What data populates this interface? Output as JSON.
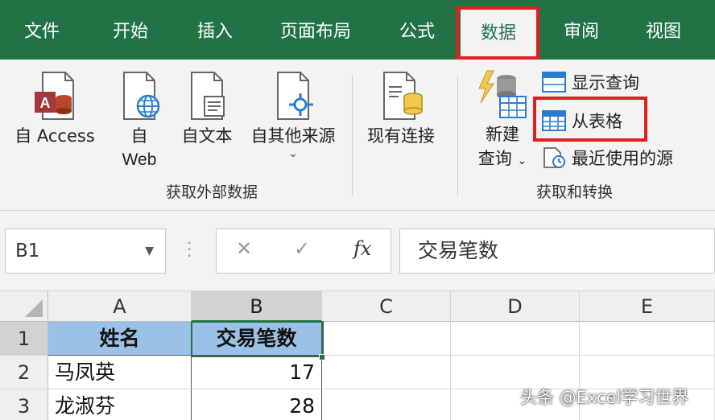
{
  "tabs": [
    {
      "label": "文件"
    },
    {
      "label": "开始"
    },
    {
      "label": "插入"
    },
    {
      "label": "页面布局"
    },
    {
      "label": "公式"
    },
    {
      "label": "数据"
    },
    {
      "label": "审阅"
    },
    {
      "label": "视图"
    }
  ],
  "active_tab": "数据",
  "ribbon": {
    "external_group": {
      "label": "获取外部数据",
      "buttons": [
        {
          "label": "自 Access"
        },
        {
          "label_line1": "自",
          "label_line2": "Web"
        },
        {
          "label": "自文本"
        },
        {
          "label": "自其他来源"
        },
        {
          "label": "现有连接"
        }
      ]
    },
    "transform_group": {
      "label": "获取和转换",
      "new_query": {
        "line1": "新建",
        "line2": "查询"
      },
      "small_buttons": [
        {
          "label": "显示查询"
        },
        {
          "label": "从表格"
        },
        {
          "label": "最近使用的源"
        }
      ]
    }
  },
  "formula_bar": {
    "name_box": "B1",
    "cancel_symbol": "✕",
    "enter_symbol": "✓",
    "fx_symbol": "fx",
    "content": "交易笔数"
  },
  "sheet": {
    "columns": [
      "A",
      "B",
      "C",
      "D",
      "E"
    ],
    "rows": [
      "1",
      "2",
      "3"
    ],
    "cells": {
      "A1": "姓名",
      "B1": "交易笔数",
      "A2": "马凤英",
      "B2": "17",
      "A3": "龙淑芬",
      "B3": "28"
    },
    "selected_cell": "B1"
  },
  "watermark": "头条 @Excel学习世界",
  "colors": {
    "ribbon_green": "#217346",
    "highlight_red": "#e0201f",
    "header_fill": "#9bc2e6"
  }
}
